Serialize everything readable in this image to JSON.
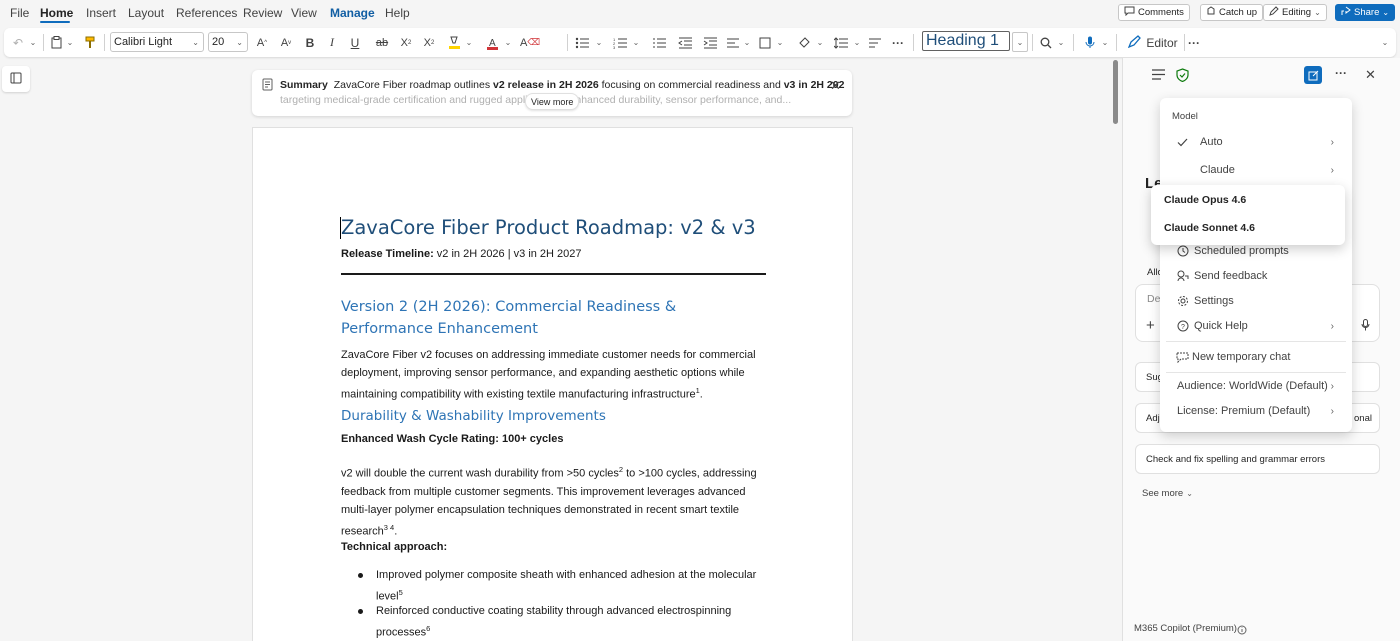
{
  "menubar": {
    "tabs": [
      {
        "label": "File"
      },
      {
        "label": "Home"
      },
      {
        "label": "Insert"
      },
      {
        "label": "Layout"
      },
      {
        "label": "References"
      },
      {
        "label": "Review"
      },
      {
        "label": "View"
      },
      {
        "label": "Manage"
      },
      {
        "label": "Help"
      }
    ],
    "active_tab": "Home",
    "comments_label": "Comments",
    "catchup_label": "Catch up",
    "editing_label": "Editing",
    "share_label": "Share"
  },
  "ribbon": {
    "font_name": "Calibri Light",
    "font_size": "20",
    "style": "Heading 1",
    "editor_label": "Editor",
    "font_color": "#d13438",
    "highlight_color": "#ffd400"
  },
  "summary": {
    "label": "Summary",
    "text_pre": "ZavaCore Fiber roadmap outlines ",
    "bold1": "v2 release in 2H 2026",
    "text_mid": " focusing on commercial readiness and ",
    "bold2": "v3 in 2H 202",
    "line2": "targeting medical-grade certification and rugged appli        alances enhanced durability, sensor performance, and...",
    "view_more": "View more"
  },
  "document": {
    "title": "ZavaCore Fiber Product Roadmap: v2 & v3",
    "timeline_label": "Release Timeline:",
    "timeline_value": " v2 in 2H 2026 | v3 in 2H 2027",
    "h1": "Version 2 (2H 2026): Commercial Readiness & Performance Enhancement",
    "p1": "ZavaCore Fiber v2 focuses on addressing immediate customer needs for commercial deployment, improving sensor performance, and expanding aesthetic options while maintaining compatibility with existing textile manufacturing infrastructure",
    "p1_sup": "1",
    "h2": "Durability & Washability Improvements",
    "bold1": "Enhanced Wash Cycle Rating: 100+ cycles",
    "p2_a": "v2 will double the current wash durability from >50 cycles",
    "p2_sup1": "2",
    "p2_b": " to >100 cycles, addressing feedback from multiple customer segments. This improvement leverages advanced multi-layer polymer encapsulation techniques demonstrated in recent smart textile research",
    "p2_sup2": "3 4",
    "bold2": "Technical approach:",
    "bullets": [
      {
        "text": "Improved polymer composite sheath with enhanced adhesion at the molecular level",
        "sup": "5"
      },
      {
        "text": "Reinforced conductive coating stability through advanced electrospinning processes",
        "sup": "6"
      }
    ]
  },
  "pane": {
    "partial_heading": "Le",
    "partial_allow": "Allo",
    "partial_input": "De",
    "partial_sug": "Sug",
    "partial_adj": "Adj",
    "partial_onal": "onal",
    "suggestion": "Check and fix spelling and grammar errors",
    "see_more": "See more",
    "footer": "M365 Copilot (Premium)"
  },
  "menu": {
    "section_label": "Model",
    "items": [
      {
        "label": "Auto",
        "icon": "check-icon"
      },
      {
        "label": "Claude",
        "icon": ""
      },
      {
        "label": "Scheduled prompts",
        "icon": "clock-icon"
      },
      {
        "label": "Send feedback",
        "icon": "feedback-icon"
      },
      {
        "label": "Settings",
        "icon": "gear-icon"
      },
      {
        "label": "Quick Help",
        "icon": "help-icon"
      },
      {
        "label": "New temporary chat",
        "icon": "temp-chat-icon"
      },
      {
        "label": "Audience: WorldWide (Default)",
        "icon": ""
      },
      {
        "label": "License: Premium (Default)",
        "icon": ""
      }
    ]
  },
  "submenu": {
    "items": [
      {
        "label": "Claude Opus 4.6"
      },
      {
        "label": "Claude Sonnet 4.6"
      }
    ]
  }
}
